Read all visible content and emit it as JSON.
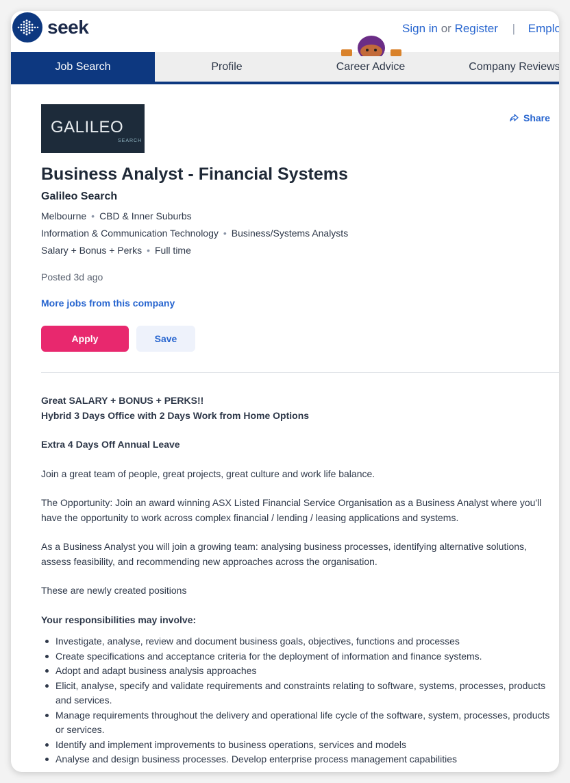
{
  "brand": {
    "logo_text": "seek"
  },
  "auth": {
    "sign_in": "Sign in",
    "or": "or",
    "register": "Register",
    "employer": "Employer"
  },
  "nav": {
    "tabs": [
      {
        "label": "Job Search"
      },
      {
        "label": "Profile"
      },
      {
        "label": "Career Advice"
      },
      {
        "label": "Company Reviews"
      }
    ]
  },
  "company_logo": {
    "wordmark": "GALILEO",
    "subword": "SEARCH"
  },
  "share_label": "Share",
  "job": {
    "title": "Business Analyst - Financial Systems",
    "company": "Galileo Search",
    "location": "Melbourne",
    "area": "CBD & Inner Suburbs",
    "classification": "Information & Communication Technology",
    "subclassification": "Business/Systems Analysts",
    "salary": "Salary + Bonus + Perks",
    "work_type": "Full time",
    "posted": "Posted 3d ago",
    "more_jobs": "More jobs from this company"
  },
  "actions": {
    "apply": "Apply",
    "save": "Save"
  },
  "description": {
    "headline1": "Great SALARY + BONUS + PERKS!!",
    "headline2": "Hybrid 3 Days Office with 2 Days Work from Home Options",
    "headline3": "Extra 4 Days Off Annual Leave",
    "para1": "Join a great team of people, great projects, great culture and work life balance.",
    "para2": "The Opportunity: Join an award winning ASX Listed Financial Service Organisation as a Business Analyst where you'll have the opportunity to work across complex financial / lending / leasing applications and systems.",
    "para3": "As a Business Analyst you will join a growing team: analysing business processes, identifying alternative solutions, assess feasibility, and recommending new approaches across the organisation.",
    "para4": "These are newly created positions",
    "resp_heading": "Your responsibilities may involve:",
    "responsibilities": [
      "Investigate, analyse, review and document business goals, objectives, functions and processes",
      "Create specifications and acceptance criteria for the deployment of information and finance systems.",
      "Adopt and adapt business analysis approaches",
      "Elicit, analyse, specify and validate requirements and constraints relating to software, systems, processes, products and services.",
      "Manage requirements throughout the delivery and operational life cycle of the software, system, processes, products or services.",
      "Identify and implement improvements to business operations, services and models",
      "Analyse and design business processes. Develop enterprise process management capabilities"
    ]
  },
  "colors": {
    "brand_navy": "#0d3880",
    "link_blue": "#2765cf",
    "apply_pink": "#e8286e"
  }
}
